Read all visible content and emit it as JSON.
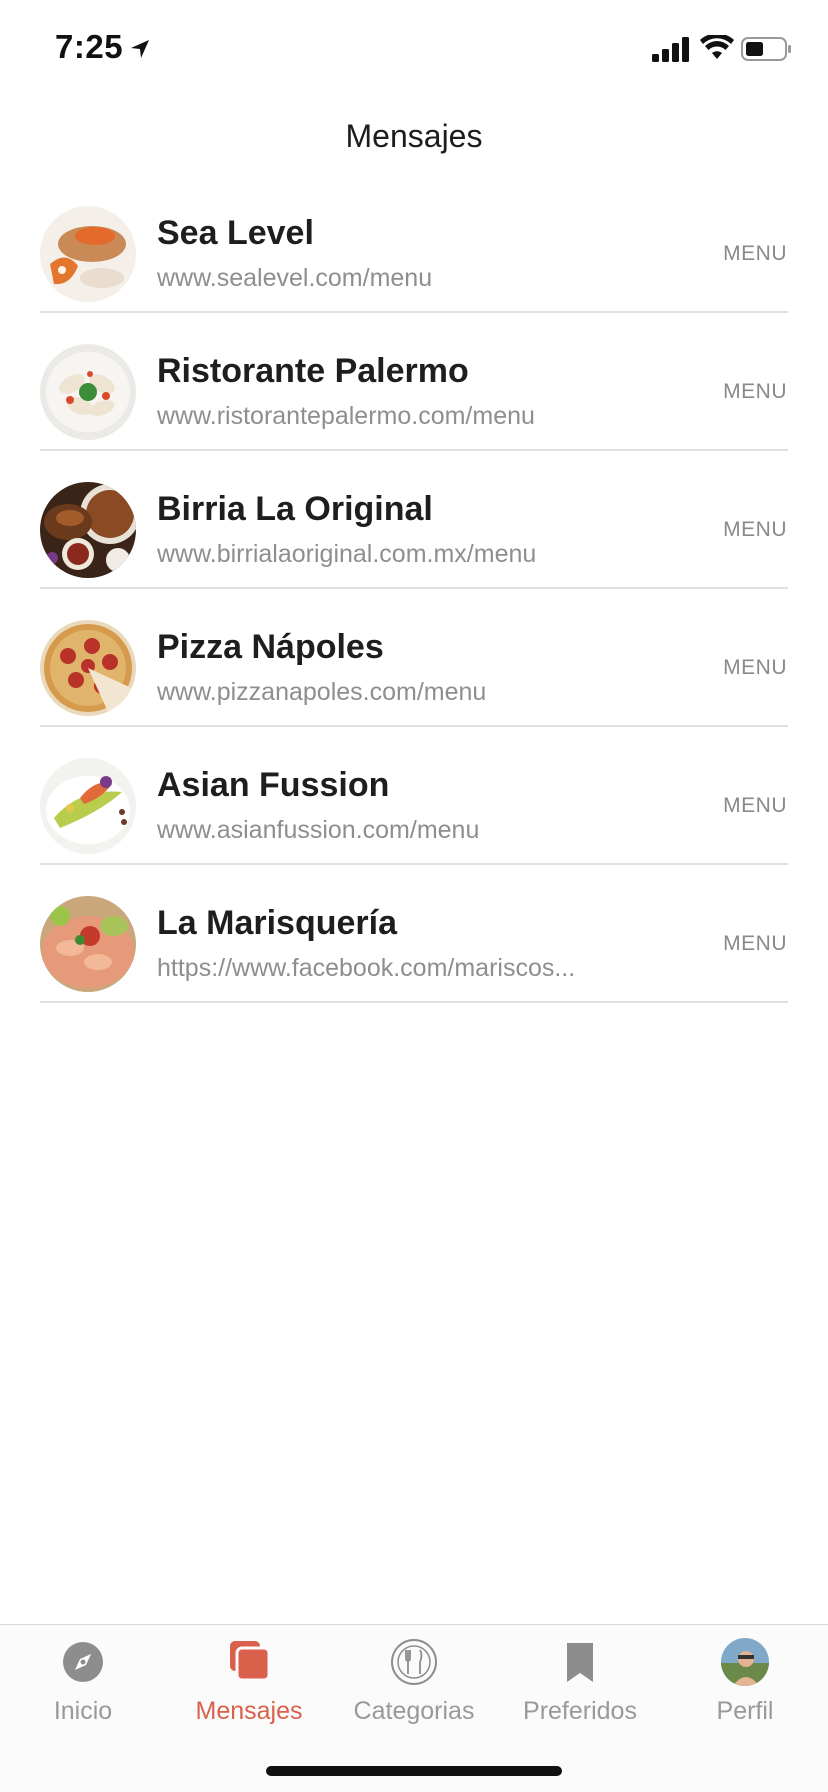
{
  "status": {
    "time": "7:25"
  },
  "header": {
    "title": "Mensajes"
  },
  "restaurants": [
    {
      "name": "Sea Level",
      "url": "www.sealevel.com/menu",
      "action": "MENU"
    },
    {
      "name": "Ristorante Palermo",
      "url": "www.ristorantepalermo.com/menu",
      "action": "MENU"
    },
    {
      "name": "Birria La Original",
      "url": "www.birrialaoriginal.com.mx/menu",
      "action": "MENU"
    },
    {
      "name": "Pizza Nápoles",
      "url": "www.pizzanapoles.com/menu",
      "action": "MENU"
    },
    {
      "name": "Asian Fussion",
      "url": "www.asianfussion.com/menu",
      "action": "MENU"
    },
    {
      "name": "La Marisquería",
      "url": "https://www.facebook.com/mariscos...",
      "action": "MENU"
    }
  ],
  "tabs": [
    {
      "label": "Inicio",
      "icon": "compass-icon",
      "active": false
    },
    {
      "label": "Mensajes",
      "icon": "messages-icon",
      "active": true
    },
    {
      "label": "Categorias",
      "icon": "plate-cutlery-icon",
      "active": false
    },
    {
      "label": "Preferidos",
      "icon": "bookmark-icon",
      "active": false
    },
    {
      "label": "Perfil",
      "icon": "profile-avatar",
      "active": false
    }
  ],
  "colors": {
    "accent": "#d9604a",
    "inactive": "#999999"
  }
}
